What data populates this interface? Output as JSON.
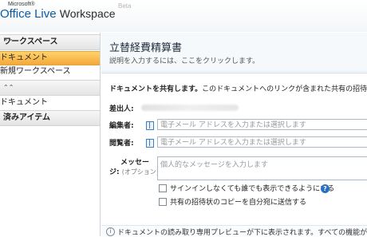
{
  "header": {
    "logo_small": "Microsoft®",
    "logo_main": "Office Live",
    "logo_ws": "Workspace",
    "beta": "Beta"
  },
  "sidebar": {
    "section1_title": "ワークスペース",
    "items1": [
      "ドキュメント",
      "新規ワークスペース"
    ],
    "section2_title": "",
    "items2": [
      "ドキュメント"
    ],
    "section3_title": "済みアイテム"
  },
  "main": {
    "title": "立替経費精算書",
    "subtitle": "説明を入力するには、ここをクリックします。",
    "share_bold": "ドキュメントを共有します。",
    "share_rest": "このドキュメントへのリンクが含まれた共有の招待状を",
    "sender_label": "差出人:",
    "editor_label": "編集者:",
    "editor_placeholder": "電子メール アドレスを入力または選択します",
    "viewer_label": "閲覧者:",
    "viewer_placeholder": "電子メール アドレスを入力または選択します",
    "message_label": "メッセー",
    "message_label2": "ジ:",
    "message_optional": "(オプション)",
    "message_placeholder": "個人的なメッセージを入力します",
    "checkbox1": "サインインしなくても誰でも表示できるようにする",
    "checkbox2": "共有の招待状のコピーを自分宛に送信する",
    "bottom_text": "ドキュメントの読み取り専用プレビューが下に表示されます。すべての機能が使"
  }
}
